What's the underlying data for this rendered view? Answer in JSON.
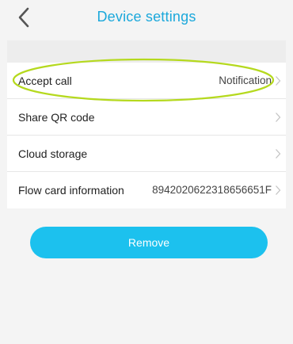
{
  "header": {
    "title": "Device settings",
    "back_icon": "chevron-left-icon"
  },
  "settings": [
    {
      "label": "Accept call",
      "value": "Notification"
    },
    {
      "label": "Share QR code",
      "value": ""
    },
    {
      "label": "Cloud storage",
      "value": ""
    },
    {
      "label": "Flow card information",
      "value": "8942020622318656651F"
    }
  ],
  "remove_button": {
    "label": "Remove"
  },
  "colors": {
    "title": "#1ba8db",
    "button": "#1cc1ee",
    "highlight_ring": "#b5d91e"
  }
}
